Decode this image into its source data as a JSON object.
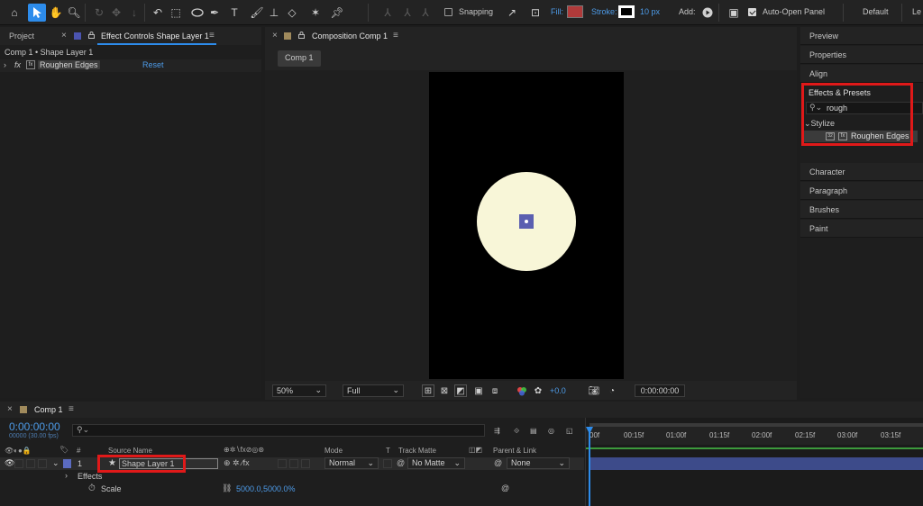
{
  "toolbar": {
    "snapping_label": "Snapping",
    "fill_label": "Fill:",
    "stroke_label": "Stroke:",
    "stroke_value": "10 px",
    "add_label": "Add:",
    "auto_open_label": "Auto-Open Panel",
    "workspace_label": "Default",
    "fill_color": "#b03a3a",
    "stroke_color": "#ffffff",
    "snapping_checked": false,
    "auto_open_checked": true
  },
  "left_panel": {
    "tab_project": "Project",
    "tab_effect_controls": "Effect Controls Shape Layer 1",
    "breadcrumb": "Comp 1 • Shape Layer 1",
    "effect_fx": "fx",
    "effect_name": "Roughen Edges",
    "reset_label": "Reset"
  },
  "composition": {
    "tab_label": "Composition Comp 1",
    "comp_tab": "Comp 1",
    "zoom": "50%",
    "resolution": "Full",
    "exposure": "+0.0",
    "timecode": "0:00:00:00",
    "circle_color": "#f8f6d8",
    "anchor_color": "#5b5fb0"
  },
  "right_panel": {
    "items_top": [
      "Preview",
      "Properties",
      "Align"
    ],
    "effects_presets_label": "Effects & Presets",
    "search_value": "rough",
    "category": "Stylize",
    "result": "Roughen Edges",
    "items_bottom": [
      "Character",
      "Paragraph",
      "Brushes",
      "Paint"
    ]
  },
  "timeline": {
    "tab_label": "Comp 1",
    "timecode": "0:00:00:00",
    "frame_info": "00000 (30.00 fps)",
    "columns": {
      "num": "#",
      "source": "Source Name",
      "mode": "Mode",
      "t": "T",
      "track_matte": "Track Matte",
      "parent": "Parent & Link"
    },
    "layer": {
      "number": "1",
      "name": "Shape Layer 1",
      "mode": "Normal",
      "matte": "No Matte",
      "parent": "None"
    },
    "effects_label": "Effects",
    "scale_label": "Scale",
    "scale_value": "5000.0,5000.0%",
    "ruler_ticks": [
      "00f",
      "00:15f",
      "01:00f",
      "01:15f",
      "02:00f",
      "02:15f",
      "03:00f",
      "03:15f"
    ],
    "layer_bar_color": "#3d4b8a",
    "label_color": "#5b6bc0"
  }
}
